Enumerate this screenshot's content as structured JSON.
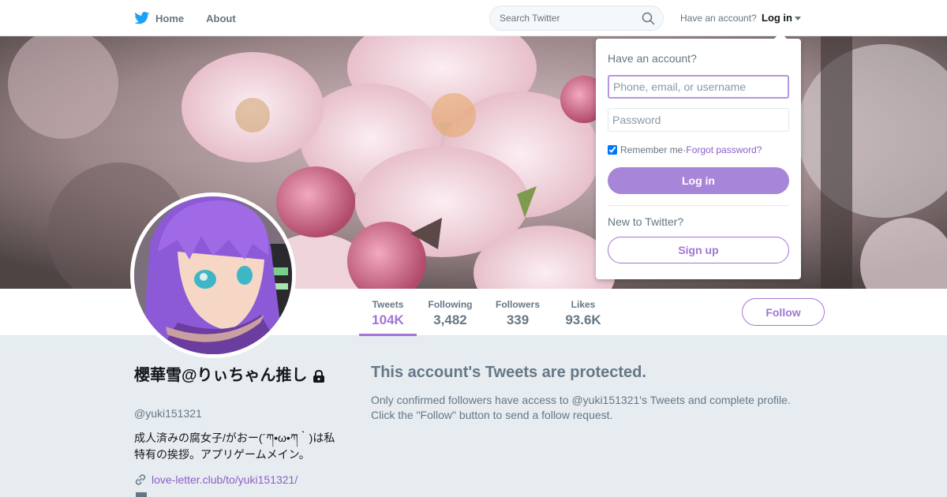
{
  "nav": {
    "home_label": "Home",
    "about_label": "About",
    "search_placeholder": "Search Twitter",
    "have_account": "Have an account?",
    "login_label": "Log in"
  },
  "profile": {
    "name": "櫻華雪@りぃちゃん推し",
    "handle": "@yuki151321",
    "bio": "成人済みの腐女子/がおー(´ཀ•ω•ཀ｀)は私特有の挨拶。アプリゲームメイン。",
    "link": "love-letter.club/to/yuki151321/"
  },
  "stats": [
    {
      "label": "Tweets",
      "value": "104K"
    },
    {
      "label": "Following",
      "value": "3,482"
    },
    {
      "label": "Followers",
      "value": "339"
    },
    {
      "label": "Likes",
      "value": "93.6K"
    }
  ],
  "follow_label": "Follow",
  "protected": {
    "title": "This account's Tweets are protected.",
    "body": "Only confirmed followers have access to @yuki151321's Tweets and complete profile. Click the \"Follow\" button to send a follow request."
  },
  "login_dropdown": {
    "title": "Have an account?",
    "username_placeholder": "Phone, email, or username",
    "password_placeholder": "Password",
    "remember_label": "Remember me",
    "separator": " · ",
    "forgot_label": "Forgot password?",
    "login_button": "Log in",
    "new_label": "New to Twitter?",
    "signup_button": "Sign up"
  },
  "colors": {
    "accent": "#a275d5",
    "twitter_blue": "#1da1f2",
    "page_bg": "#e6ecf0"
  },
  "icons": [
    "twitter-bird-icon",
    "search-icon",
    "caret-down-icon",
    "lock-icon",
    "link-icon",
    "calendar-icon"
  ]
}
